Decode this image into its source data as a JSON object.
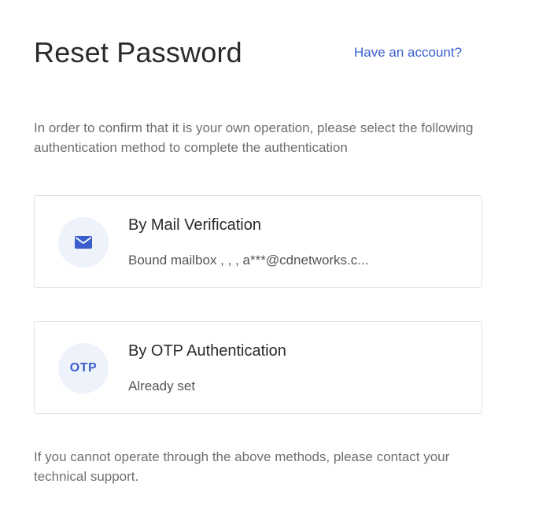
{
  "header": {
    "title": "Reset Password",
    "have_account_link": "Have an account?"
  },
  "description": "In order to confirm that it is your own operation, please select the following authentication method to complete the authentication",
  "methods": [
    {
      "title": "By Mail Verification",
      "subtitle": "Bound mailbox ,  ,  ,   a***@cdnetworks.c...",
      "icon": "mail-icon"
    },
    {
      "title": "By OTP Authentication",
      "subtitle": "Already set",
      "icon_text": "OTP"
    }
  ],
  "footer": "If you cannot operate through the above methods, please contact your technical support.",
  "colors": {
    "accent": "#3a5fcd",
    "icon_bg": "#eef2fb",
    "border": "#e3e3e3"
  }
}
